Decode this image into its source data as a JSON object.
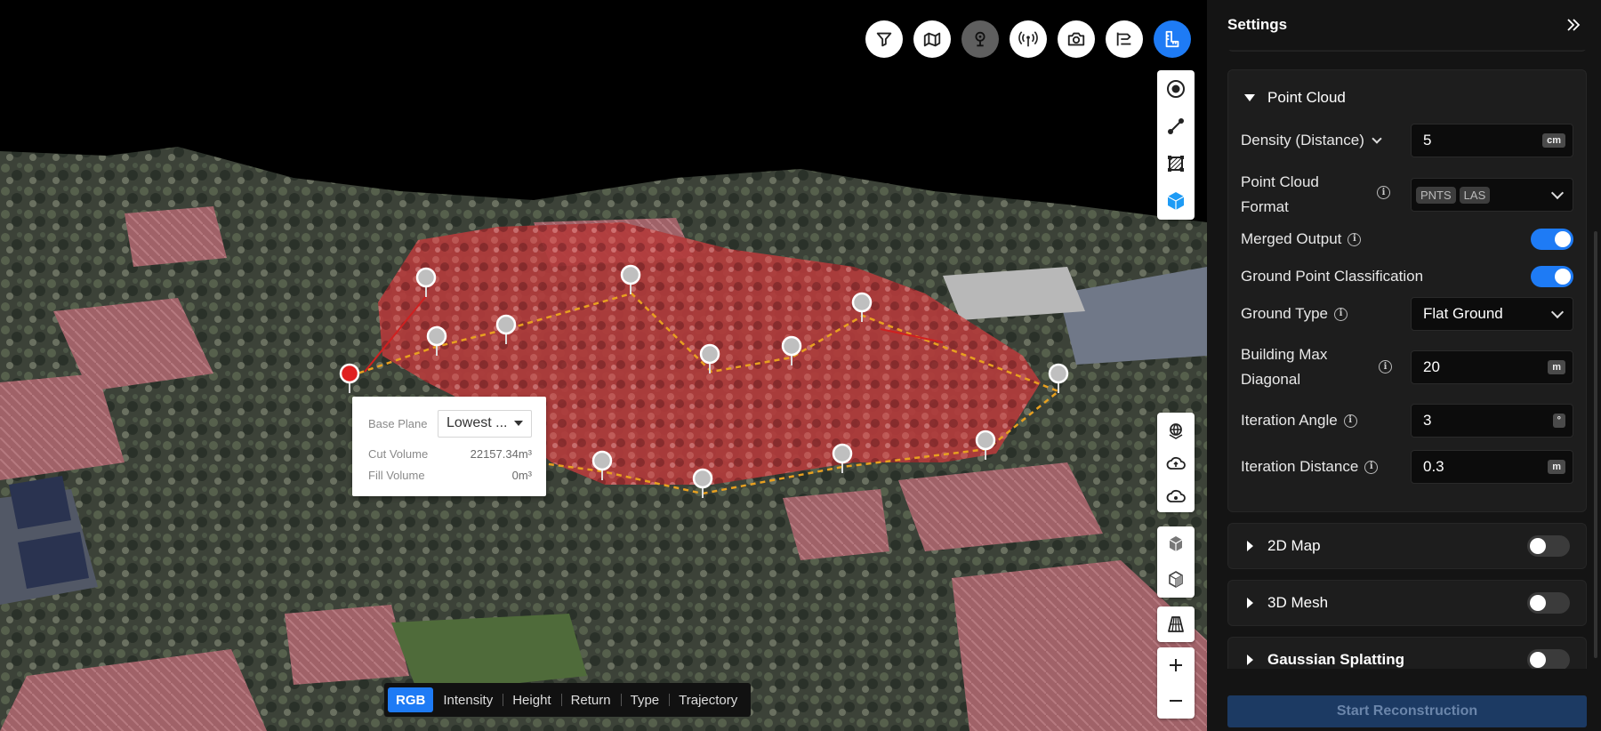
{
  "toolbar_top": {
    "icons": [
      "filter-icon",
      "map-layers-icon",
      "location-pin-icon",
      "antenna-icon",
      "camera-icon",
      "route-icon",
      "measure-icon"
    ],
    "active": "location-pin-icon"
  },
  "tools_right_top": [
    "point-measure-icon",
    "line-measure-icon",
    "area-measure-icon",
    "volume-measure-icon"
  ],
  "tools_right_bottom": [
    "globe-icon",
    "cloud-upload-icon",
    "cloud-settings-icon",
    "cube-icon",
    "cube-outline-icon",
    "perspective-grid-icon",
    "zoom-in-icon",
    "zoom-out-icon"
  ],
  "volume_popup": {
    "base_plane_label": "Base Plane",
    "base_plane_value": "Lowest ...",
    "cut_volume_label": "Cut Volume",
    "cut_volume_value": "22157.34m³",
    "fill_volume_label": "Fill Volume",
    "fill_volume_value": "0m³"
  },
  "color_modes": {
    "tabs": [
      "RGB",
      "Intensity",
      "Height",
      "Return",
      "Type",
      "Trajectory"
    ],
    "active": "RGB"
  },
  "panel": {
    "title": "Settings",
    "point_cloud": {
      "title": "Point Cloud",
      "density_label": "Density (Distance)",
      "density_value": "5",
      "density_unit": "cm",
      "format_label_line1": "Point Cloud",
      "format_label_line2": "Format",
      "format_chips": [
        "PNTS",
        "LAS"
      ],
      "merged_output_label": "Merged Output",
      "merged_output_on": true,
      "ground_classification_label": "Ground Point Classification",
      "ground_classification_on": true,
      "ground_type_label": "Ground Type",
      "ground_type_value": "Flat Ground",
      "building_label_line1": "Building Max",
      "building_label_line2": "Diagonal",
      "building_value": "20",
      "building_unit": "m",
      "iteration_angle_label": "Iteration Angle",
      "iteration_angle_value": "3",
      "iteration_angle_unit": "°",
      "iteration_distance_label": "Iteration Distance",
      "iteration_distance_value": "0.3",
      "iteration_distance_unit": "m"
    },
    "map2d": {
      "title": "2D Map",
      "on": false
    },
    "mesh3d": {
      "title": "3D Mesh",
      "on": false
    },
    "gaussian": {
      "title": "Gaussian Splatting",
      "on": false
    },
    "start_label": "Start Reconstruction"
  },
  "colors": {
    "accent": "#1e7bf5",
    "selection_fill": "#b53a3a",
    "dashed_line": "#e8a020",
    "panel_bg": "#141414"
  }
}
